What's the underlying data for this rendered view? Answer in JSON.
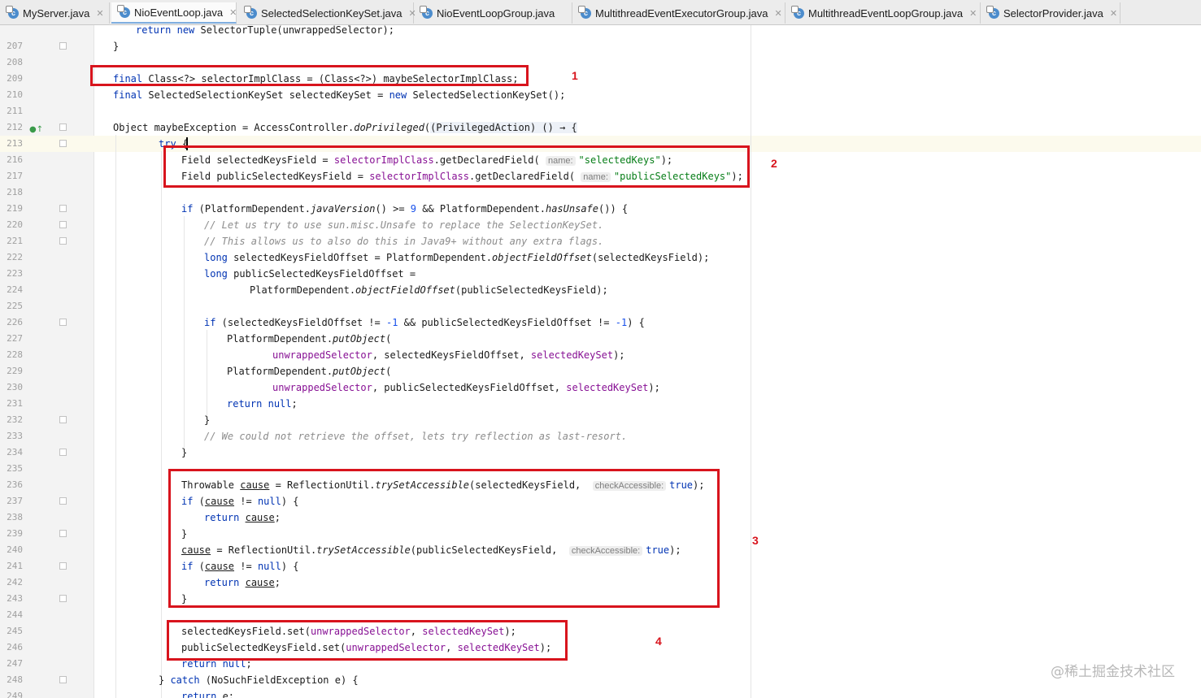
{
  "tabs": [
    {
      "label": "MyServer.java",
      "icon": "class-icon",
      "closable": true,
      "active": false
    },
    {
      "label": "NioEventLoop.java",
      "icon": "class-icon",
      "closable": true,
      "active": true
    },
    {
      "label": "SelectedSelectionKeySet.java",
      "icon": "class-icon",
      "closable": true,
      "active": false
    },
    {
      "label": "NioEventLoopGroup.java",
      "icon": "class-icon",
      "closable": false,
      "active": false
    },
    {
      "label": "MultithreadEventExecutorGroup.java",
      "icon": "class-icon",
      "closable": true,
      "active": false
    },
    {
      "label": "MultithreadEventLoopGroup.java",
      "icon": "class-icon",
      "closable": true,
      "active": false
    },
    {
      "label": "SelectorProvider.java",
      "icon": "class-icon",
      "closable": true,
      "active": false
    }
  ],
  "editor": {
    "line_numbers": [
      "207",
      "208",
      "209",
      "210",
      "211",
      "212",
      "213",
      "216",
      "217",
      "218",
      "219",
      "220",
      "221",
      "222",
      "223",
      "224",
      "225",
      "226",
      "227",
      "228",
      "229",
      "230",
      "231",
      "232",
      "233",
      "234",
      "235",
      "236",
      "237",
      "238",
      "239",
      "240",
      "241",
      "242",
      "243",
      "244",
      "245",
      "246",
      "247",
      "248",
      "249",
      "250"
    ],
    "hints": {
      "name": "name:",
      "check_accessible": "checkAccessible:"
    },
    "code": {
      "l207_return": "return",
      "l207_new": "new",
      "l207_rest": " SelectorTuple(unwrappedSelector);",
      "l208": "}",
      "l210_final": "final",
      "l210_rest": " Class<?> selectorImplClass = (Class<?>) maybeSelectorImplClass;",
      "l211_final": "final",
      "l211_mid": " SelectedSelectionKeySet selectedKeySet = ",
      "l211_new": "new",
      "l211_rest": " SelectedSelectionKeySet();",
      "l213_a": "Object maybeException = AccessController.",
      "l213_method": "doPrivileged",
      "l213_b": "(",
      "l213_lam": "(PrivilegedAction) () → {",
      "l216_try": "try",
      "l216_brace": " {",
      "l217_a": "Field selectedKeysField = ",
      "l217_field": "selectorImplClass",
      "l217_b": ".getDeclaredField(",
      "l217_str": "\"selectedKeys\"",
      "l217_c": ");",
      "l218_a": "Field publicSelectedKeysField = ",
      "l218_field": "selectorImplClass",
      "l218_b": ".getDeclaredField(",
      "l218_str": "\"publicSelectedKeys\"",
      "l218_c": ");",
      "l220_if": "if",
      "l220_a": " (PlatformDependent.",
      "l220_m1": "javaVersion",
      "l220_b": "() >= ",
      "l220_num": "9",
      "l220_c": " && PlatformDependent.",
      "l220_m2": "hasUnsafe",
      "l220_d": "()) {",
      "l221": "// Let us try to use sun.misc.Unsafe to replace the SelectionKeySet.",
      "l222": "// This allows us to also do this in Java9+ without any extra flags.",
      "l223_long": "long",
      "l223_a": " selectedKeysFieldOffset = PlatformDependent.",
      "l223_m": "objectFieldOffset",
      "l223_b": "(selectedKeysField);",
      "l224_long": "long",
      "l224_a": " publicSelectedKeysFieldOffset =",
      "l225_a": "PlatformDependent.",
      "l225_m": "objectFieldOffset",
      "l225_b": "(publicSelectedKeysField);",
      "l227_if": "if",
      "l227_a": " (selectedKeysFieldOffset != ",
      "l227_n1": "-1",
      "l227_b": " && publicSelectedKeysFieldOffset != ",
      "l227_n2": "-1",
      "l227_c": ") {",
      "l228_a": "PlatformDependent.",
      "l228_m": "putObject",
      "l228_b": "(",
      "l229_f1": "unwrappedSelector",
      "l229_a": ", selectedKeysFieldOffset, ",
      "l229_f2": "selectedKeySet",
      "l229_b": ");",
      "l230_a": "PlatformDependent.",
      "l230_m": "putObject",
      "l230_b": "(",
      "l231_f1": "unwrappedSelector",
      "l231_a": ", publicSelectedKeysFieldOffset, ",
      "l231_f2": "selectedKeySet",
      "l231_b": ");",
      "l232_return": "return",
      "l232_null": "null",
      "l232_semi": ";",
      "l233": "}",
      "l234": "// We could not retrieve the offset, lets try reflection as last-resort.",
      "l235": "}",
      "l237_a": "Throwable ",
      "l237_cause": "cause",
      "l237_b": " = ReflectionUtil.",
      "l237_m": "trySetAccessible",
      "l237_c": "(selectedKeysField, ",
      "l237_true": "true",
      "l237_d": ");",
      "l238_if": "if",
      "l238_a": " (",
      "l238_cause": "cause",
      "l238_b": " != ",
      "l238_null": "null",
      "l238_c": ") {",
      "l239_return": "return",
      "l239_cause": "cause",
      "l239_semi": ";",
      "l240": "}",
      "l241_cause": "cause",
      "l241_a": " = ReflectionUtil.",
      "l241_m": "trySetAccessible",
      "l241_b": "(publicSelectedKeysField, ",
      "l241_true": "true",
      "l241_c": ");",
      "l242_if": "if",
      "l242_a": " (",
      "l242_cause": "cause",
      "l242_b": " != ",
      "l242_null": "null",
      "l242_c": ") {",
      "l243_return": "return",
      "l243_cause": "cause",
      "l243_semi": ";",
      "l244": "}",
      "l246_a": "selectedKeysField.set(",
      "l246_f1": "unwrappedSelector",
      "l246_b": ", ",
      "l246_f2": "selectedKeySet",
      "l246_c": ");",
      "l247_a": "publicSelectedKeysField.set(",
      "l247_f1": "unwrappedSelector",
      "l247_b": ", ",
      "l247_f2": "selectedKeySet",
      "l247_c": ");",
      "l248_return": "return",
      "l248_null": "null",
      "l248_semi": ";",
      "l249_brace": "} ",
      "l249_catch": "catch",
      "l249_rest": " (NoSuchFieldException e) {",
      "l250_return": "return",
      "l250_rest": " e;"
    }
  },
  "annotations": [
    "1",
    "2",
    "3",
    "4"
  ],
  "watermark": "@稀土掘金技术社区",
  "colors": {
    "keyword": "#0033b3",
    "string": "#067d17",
    "number": "#1750eb",
    "field": "#871094",
    "comment": "#8c8c8c",
    "annotation_red": "#d8141d"
  }
}
